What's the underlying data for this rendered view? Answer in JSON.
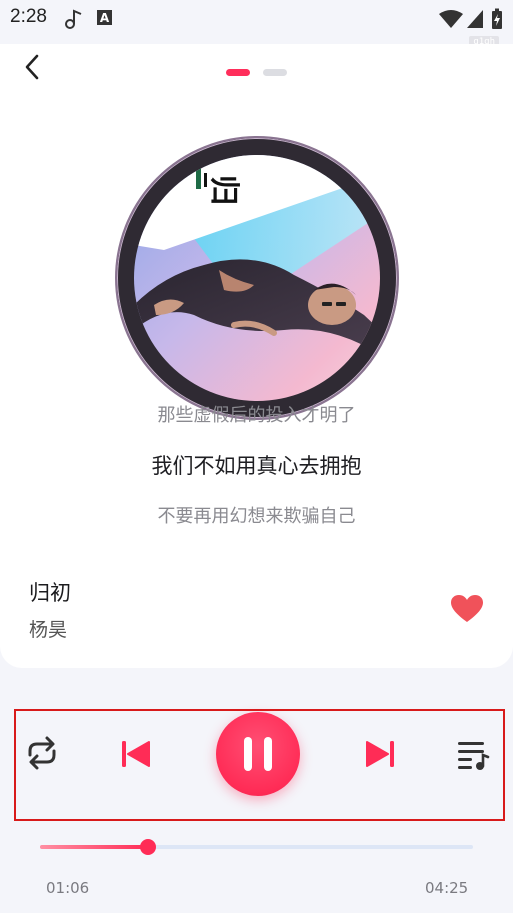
{
  "status_bar": {
    "time": "2:28",
    "icons": [
      "music-note-icon",
      "text-a-icon",
      "wifi-icon",
      "signal-icon",
      "battery-charging-icon"
    ],
    "watermark": "g1qh"
  },
  "header": {
    "back_icon": "chevron-left-icon",
    "pager": {
      "pages": 2,
      "active_index": 0
    }
  },
  "album_art": {
    "description_icon": "album-cover"
  },
  "lyrics": {
    "previous": "那些虚假后的投入才明了",
    "current": "我们不如用真心去拥抱",
    "next": "不要再用幻想来欺骗自己"
  },
  "song": {
    "title": "归初",
    "artist": "杨昊",
    "liked": true
  },
  "controls": {
    "repeat_icon": "repeat-icon",
    "previous_icon": "skip-previous-icon",
    "play_state_icon": "pause-icon",
    "next_icon": "skip-next-icon",
    "playlist_icon": "playlist-icon"
  },
  "progress": {
    "elapsed": "01:06",
    "total": "04:25",
    "fraction": 0.249
  },
  "colors": {
    "accent": "#ff2c56",
    "background": "#f4f5fa",
    "card": "#ffffff",
    "like": "#f0525a",
    "highlight_box": "#d81a1a"
  }
}
